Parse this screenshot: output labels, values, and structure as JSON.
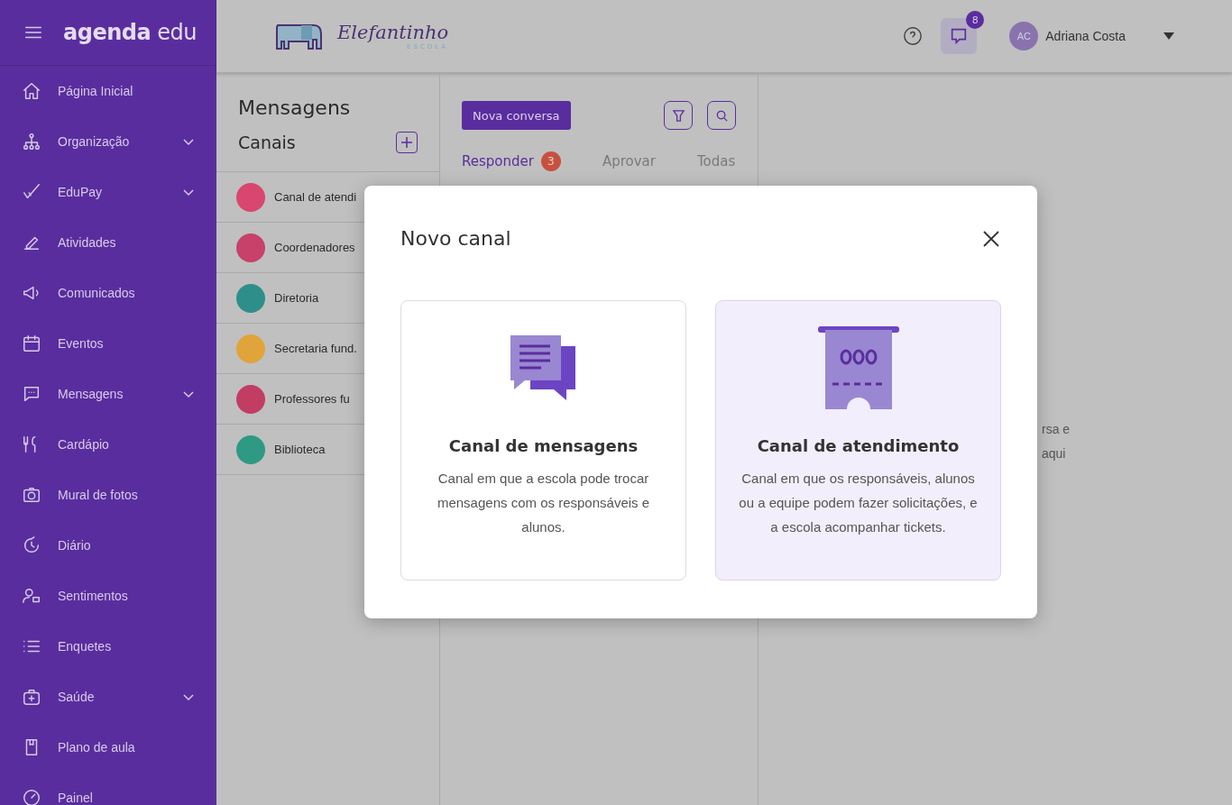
{
  "sidebar": {
    "logo": "agenda",
    "logo_suffix": "edu",
    "items": [
      {
        "label": "Página Inicial",
        "expandable": false
      },
      {
        "label": "Organização",
        "expandable": true
      },
      {
        "label": "EduPay",
        "expandable": true
      },
      {
        "label": "Atividades",
        "expandable": false
      },
      {
        "label": "Comunicados",
        "expandable": false
      },
      {
        "label": "Eventos",
        "expandable": false
      },
      {
        "label": "Mensagens",
        "expandable": true
      },
      {
        "label": "Cardápio",
        "expandable": false
      },
      {
        "label": "Mural de fotos",
        "expandable": false
      },
      {
        "label": "Diário",
        "expandable": false
      },
      {
        "label": "Sentimentos",
        "expandable": false
      },
      {
        "label": "Enquetes",
        "expandable": false
      },
      {
        "label": "Saúde",
        "expandable": true
      },
      {
        "label": "Plano de aula",
        "expandable": false
      },
      {
        "label": "Painel",
        "expandable": false
      }
    ]
  },
  "header": {
    "school_name": "Elefantinho",
    "school_subtitle": "ESCOLA",
    "messages_badge": "8",
    "user_initials": "AC",
    "user_name": "Adriana Costa"
  },
  "channels_panel": {
    "title": "Mensagens",
    "subtitle": "Canais",
    "channels": [
      {
        "name": "Canal de atendi",
        "color": "#d9466f"
      },
      {
        "name": "Coordenadores",
        "color": "#c7416b"
      },
      {
        "name": "Diretoria",
        "color": "#2e8f8a"
      },
      {
        "name": "Secretaria fund.",
        "color": "#e0a43a"
      },
      {
        "name": "Professores fu",
        "color": "#c23d64"
      },
      {
        "name": "Biblioteca",
        "color": "#2e9a84"
      }
    ]
  },
  "conversations": {
    "new_button": "Nova conversa",
    "tabs": [
      {
        "label": "Responder",
        "selected": true,
        "badge": "3"
      },
      {
        "label": "Aprovar",
        "selected": false
      },
      {
        "label": "Todas",
        "selected": false
      }
    ]
  },
  "detail": {
    "lines": [
      "rsa e",
      "aqui"
    ]
  },
  "modal": {
    "title": "Novo canal",
    "options": [
      {
        "kind": "messages",
        "title": "Canal de mensagens",
        "description": "Canal em que a escola pode trocar mensagens com os responsáveis e alunos.",
        "highlighted": false
      },
      {
        "kind": "service",
        "title": "Canal de atendimento",
        "description": "Canal em que os responsáveis, alunos ou a equipe podem fazer solicitações, e a escola acompanhar tickets.",
        "highlighted": true
      }
    ]
  }
}
